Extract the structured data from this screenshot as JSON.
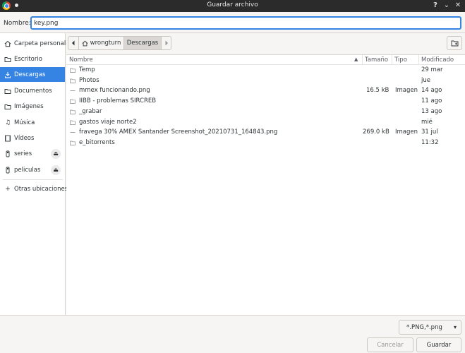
{
  "window": {
    "title": "Guardar archivo"
  },
  "name_field": {
    "label": "Nombre:",
    "value": "key.png"
  },
  "sidebar": {
    "items": [
      {
        "label": "Carpeta personal",
        "icon": "home-icon"
      },
      {
        "label": "Escritorio",
        "icon": "folder-icon"
      },
      {
        "label": "Descargas",
        "icon": "download-icon",
        "active": true
      },
      {
        "label": "Documentos",
        "icon": "folder-icon"
      },
      {
        "label": "Imágenes",
        "icon": "folder-icon"
      },
      {
        "label": "Música",
        "icon": "music-icon"
      },
      {
        "label": "Vídeos",
        "icon": "video-icon"
      },
      {
        "label": "series",
        "icon": "drive-icon",
        "eject": true
      },
      {
        "label": "peliculas",
        "icon": "drive-icon",
        "eject": true
      },
      {
        "label": "Otras ubicaciones",
        "icon": "plus-icon"
      }
    ]
  },
  "pathbar": {
    "home_label": "wrongturn",
    "current_label": "Descargas"
  },
  "columns": {
    "name": "Nombre",
    "size": "Tamaño",
    "type": "Tipo",
    "modified": "Modificado"
  },
  "files": [
    {
      "name": "Temp",
      "size": "",
      "type": "",
      "modified": "29 mar",
      "kind": "folder"
    },
    {
      "name": "Photos",
      "size": "",
      "type": "",
      "modified": "jue",
      "kind": "folder"
    },
    {
      "name": "mmex funcionando.png",
      "size": "16.5 kB",
      "type": "Imagen",
      "modified": "14 ago",
      "kind": "image"
    },
    {
      "name": "IIBB - problemas SIRCREB",
      "size": "",
      "type": "",
      "modified": "11 ago",
      "kind": "folder"
    },
    {
      "name": "_grabar",
      "size": "",
      "type": "",
      "modified": "13 ago",
      "kind": "folder"
    },
    {
      "name": "gastos viaje norte2",
      "size": "",
      "type": "",
      "modified": "mié",
      "kind": "folder"
    },
    {
      "name": "fravega 30% AMEX Santander Screenshot_20210731_164843.png",
      "size": "269.0 kB",
      "type": "Imagen",
      "modified": "31 jul",
      "kind": "image"
    },
    {
      "name": "e_bitorrents",
      "size": "",
      "type": "",
      "modified": "11:32",
      "kind": "folder"
    }
  ],
  "filter": {
    "value": "*.PNG,*.png"
  },
  "buttons": {
    "cancel": "Cancelar",
    "save": "Guardar"
  },
  "colors": {
    "accent": "#3584e4",
    "titlebar": "#2b2b2b"
  }
}
